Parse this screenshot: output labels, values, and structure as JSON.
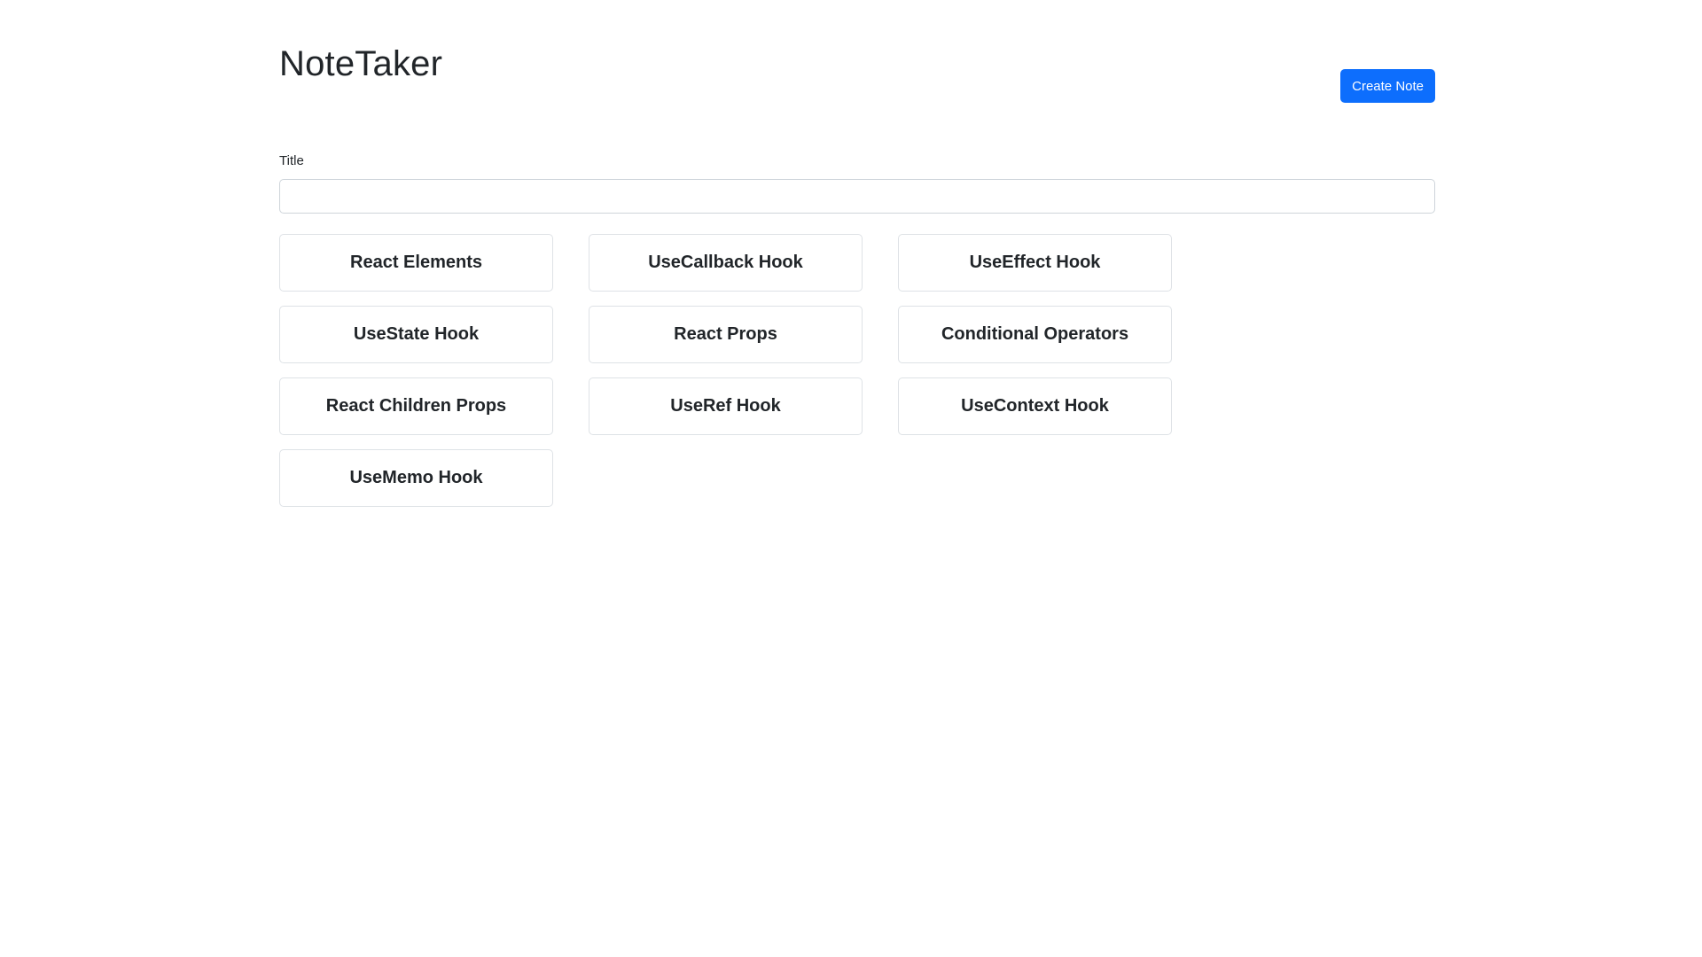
{
  "header": {
    "app_title": "NoteTaker",
    "create_button_label": "Create Note"
  },
  "form": {
    "title_label": "Title",
    "title_value": "",
    "title_placeholder": ""
  },
  "notes": [
    {
      "title": "React Elements"
    },
    {
      "title": "UseCallback Hook"
    },
    {
      "title": "UseEffect Hook"
    },
    {
      "title": "UseState Hook"
    },
    {
      "title": "React Props"
    },
    {
      "title": "Conditional Operators"
    },
    {
      "title": "React Children Props"
    },
    {
      "title": "UseRef Hook"
    },
    {
      "title": "UseContext Hook"
    },
    {
      "title": "UseMemo Hook"
    }
  ],
  "colors": {
    "primary": "#0d6efd",
    "text": "#212529",
    "border": "#dee2e6"
  }
}
